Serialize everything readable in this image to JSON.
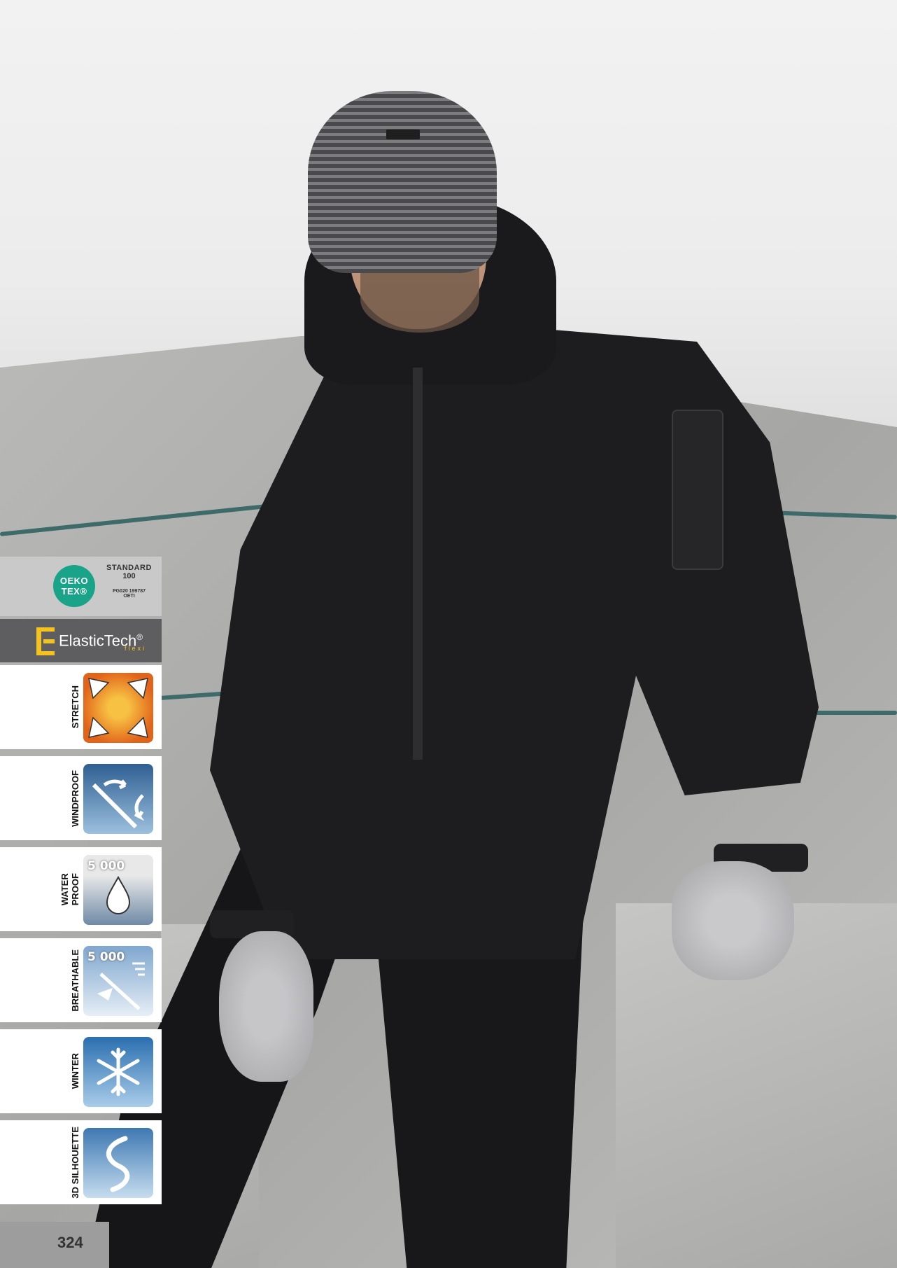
{
  "page": {
    "number": "324"
  },
  "certification": {
    "logo_line1": "OEKO",
    "logo_line2": "TEX®",
    "standard_line1": "STANDARD",
    "standard_line2": "100",
    "code_line1": "PG020 199787",
    "code_line2": "OETI"
  },
  "technology": {
    "name": "ElasticTech",
    "registered": "®",
    "sub": "flexi",
    "brand_color": "#f3c21e"
  },
  "features": [
    {
      "label": "STRETCH",
      "icon": "stretch-icon",
      "value": ""
    },
    {
      "label": "WINDPROOF",
      "icon": "wind-icon",
      "value": ""
    },
    {
      "label": "WATER\nPROOF",
      "icon": "waterdrop-icon",
      "value": "5 000"
    },
    {
      "label": "BREATHABLE",
      "icon": "breathable-icon",
      "value": "5 000"
    },
    {
      "label": "WINTER",
      "icon": "snowflake-icon",
      "value": ""
    },
    {
      "label": "3D SILHOUETTE",
      "icon": "silhouette-icon",
      "value": ""
    }
  ],
  "colors": {
    "oeko_green": "#19a389",
    "sidebar_dark": "#5e5e60",
    "stretch_orange": "#e2631a",
    "sky_blue": "#4d7fb0"
  }
}
